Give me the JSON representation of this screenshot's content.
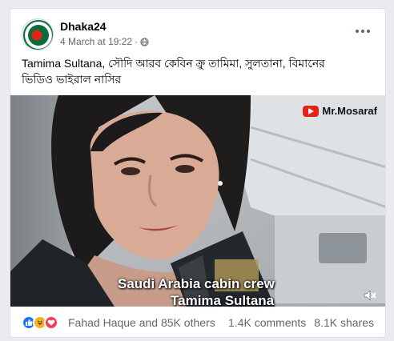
{
  "post": {
    "page_name": "Dhaka24",
    "timestamp": "4 March at 19:22",
    "privacy_icon": "globe-icon",
    "more_icon": "more-horizontal-icon",
    "text_line1": "Tamima Sultana, সৌদি আরব কেবিন ক্রু তামিমা, সুলতানা, বিমানের",
    "text_line2": "ভিডিও ভাইরাল নাসির"
  },
  "video": {
    "watermark": "Mr.Mosaraf",
    "caption_line1": "Saudi Arabia cabin crew",
    "caption_line2": "Tamima Sultana",
    "mute_icon": "volume-muted-icon"
  },
  "engagement": {
    "reactions": [
      "like",
      "haha",
      "love"
    ],
    "reactors": "Fahad Haque and 85K others",
    "comments": "1.4K comments",
    "shares": "8.1K shares"
  },
  "colors": {
    "like": "#1877f2",
    "haha": "#f7b125",
    "love": "#f33e58",
    "youtube_red": "#e62117",
    "meta_text": "#65676b"
  }
}
